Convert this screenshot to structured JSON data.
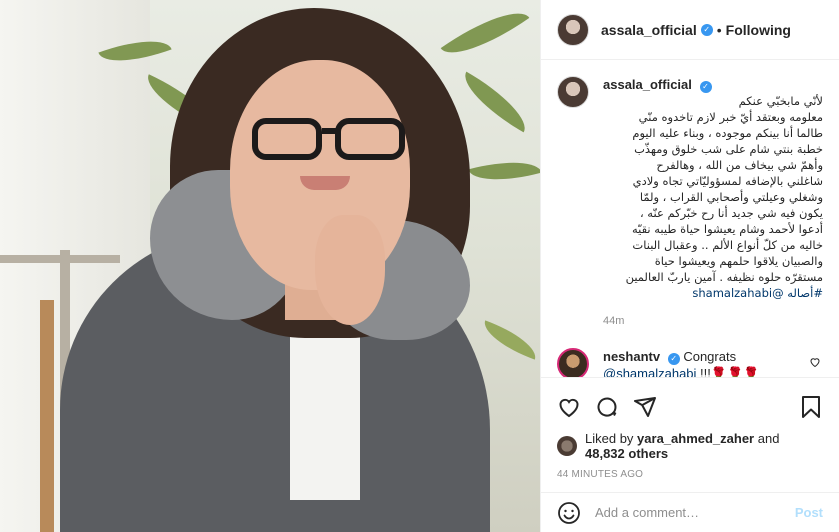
{
  "post": {
    "username": "assala_official",
    "follow_status": "Following",
    "caption_user": "assala_official",
    "caption_lines": [
      "لأنّي مابخبّي عنكم",
      "معلومه وبعتقد أيّ خبر لازم تاخدوه منّي",
      "طالما أنا بينكم موجوده ، وبناء عليه اليوم",
      "خطبة بنتي شام على شب خلوق ومهذّب",
      "وأهمّ شي بيخاف من الله ، وهالفرح",
      "شاغلني بالإضافه لمسؤوليّاتي تجاه ولادي",
      "وشغلي وعيلتي وأصحابي القراب ، ولمّا",
      "يكون فيه شي جديد أنا رح خبّركم عنّه ،",
      "أدعوا لأحمد وشام يعيشوا حياة طيبه نقيّه",
      "خاليه من كلّ أنواع الألم .. وعقبال البنات",
      "والصبيان يلاقوا حلمهم ويعيشوا حياة",
      "مستقرّه حلوه نظيفه . آمين ياربّ العالمين"
    ],
    "caption_tail": {
      "hashtag": "#أصاله",
      "mention": "@shamalzahabi"
    },
    "caption_time": "44m"
  },
  "comment": {
    "username": "neshantv",
    "text": "Congrats",
    "mention": "@shamalzahabi",
    "suffix": "!!!🌹🌹🌹"
  },
  "likes": {
    "prefix": "Liked by",
    "by_user": "yara_ahmed_zaher",
    "and": "and",
    "others": "48,832 others"
  },
  "timestamp": "44 MINUTES AGO",
  "add_comment": {
    "placeholder": "Add a comment…",
    "post_label": "Post"
  },
  "colors": {
    "link": "#00376b",
    "verified": "#3897f0",
    "muted": "#8e8e8e",
    "post_disabled": "#b2dffc"
  },
  "icons": [
    "verified-badge-icon",
    "heart-icon",
    "comment-icon",
    "share-icon",
    "bookmark-icon",
    "smiley-icon"
  ]
}
